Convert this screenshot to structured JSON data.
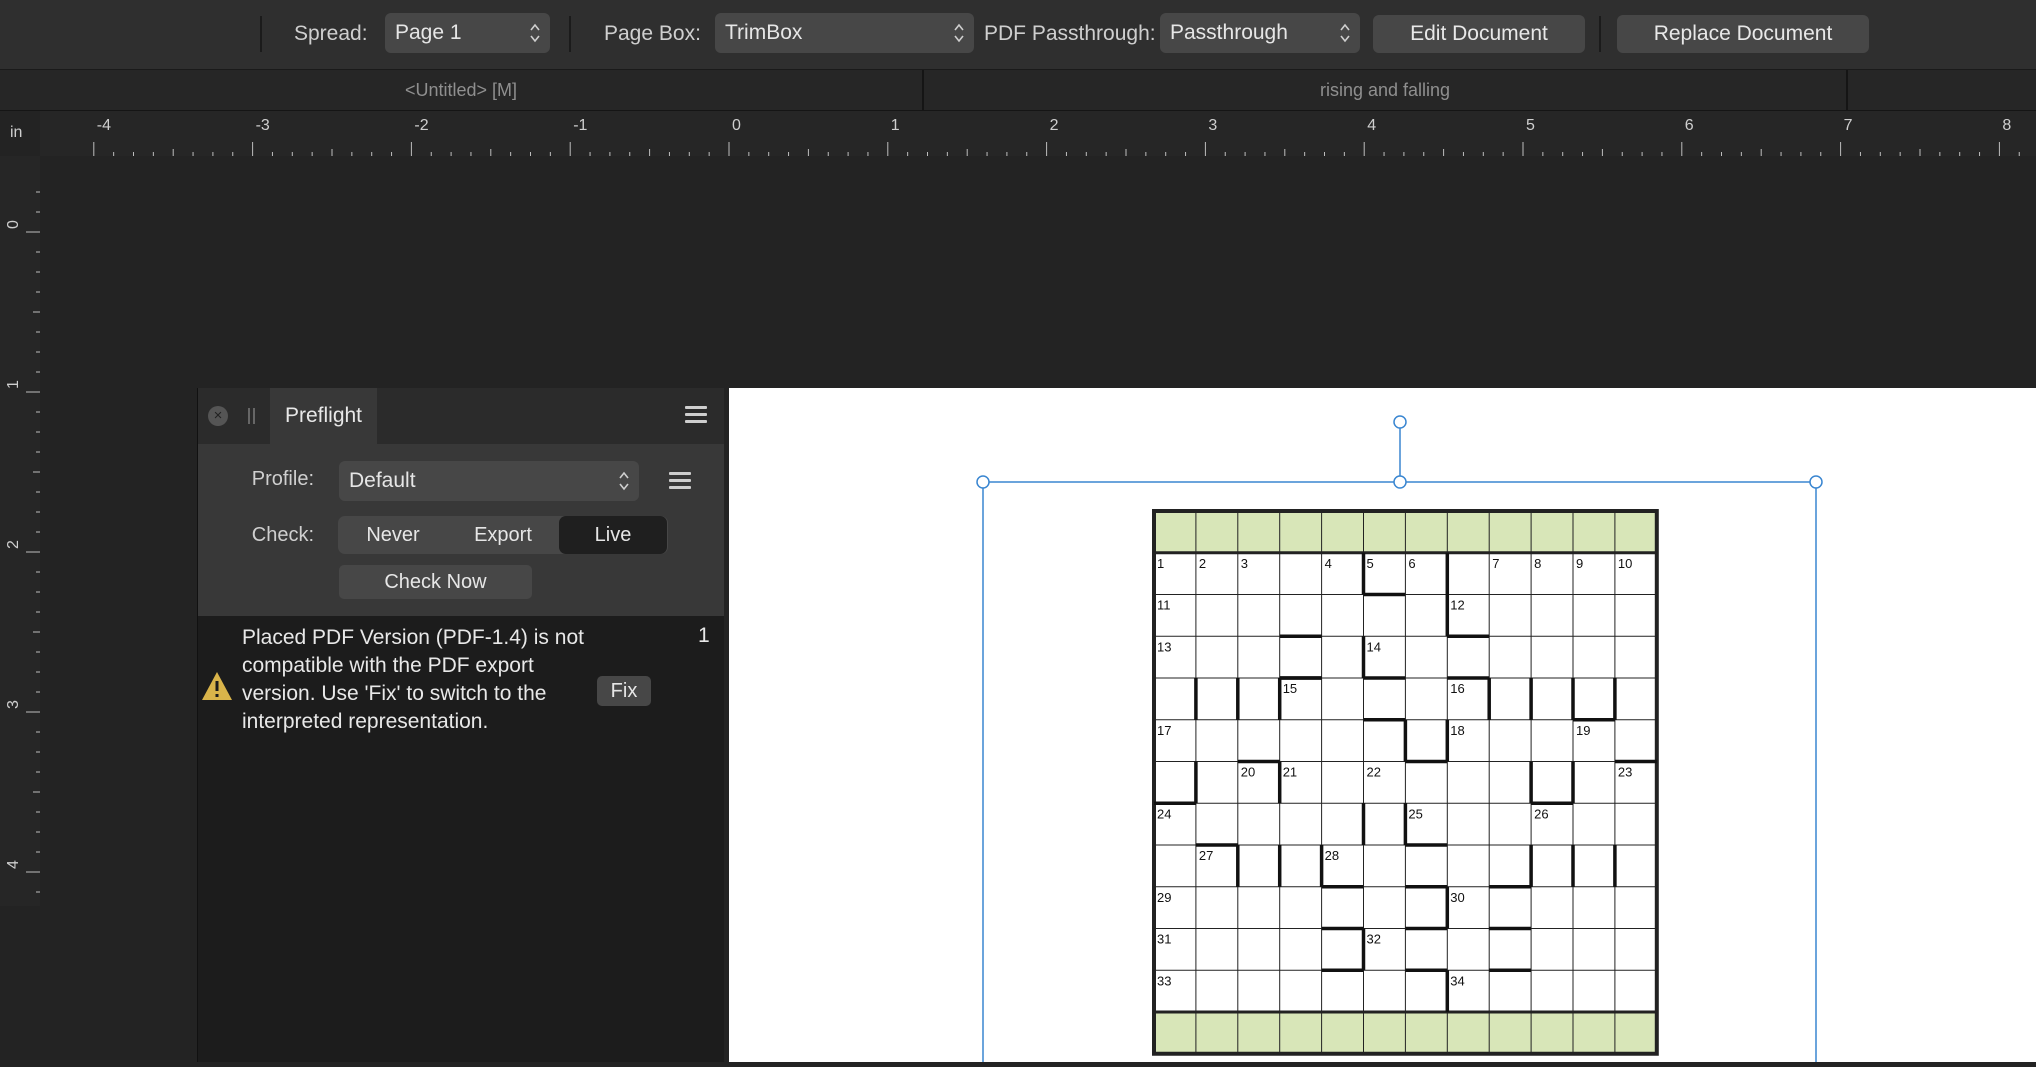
{
  "toolbar": {
    "spread_label": "Spread:",
    "spread_value": "Page 1",
    "pagebox_label": "Page Box:",
    "pagebox_value": "TrimBox",
    "passthrough_label": "PDF Passthrough:",
    "passthrough_value": "Passthrough",
    "edit_document": "Edit Document",
    "replace_document": "Replace Document"
  },
  "tabs": [
    {
      "label": "<Untitled> [M]"
    },
    {
      "label": "rising and falling"
    }
  ],
  "ruler": {
    "unit": "in",
    "h_labels": [
      "-4",
      "-3",
      "-2",
      "-1",
      "0",
      "1",
      "2",
      "3",
      "4",
      "5",
      "6",
      "7",
      "8"
    ],
    "v_labels": [
      "0",
      "1",
      "2",
      "3",
      "4"
    ]
  },
  "preflight": {
    "tab_label": "Preflight",
    "close_symbol": "×",
    "profile_label": "Profile:",
    "profile_value": "Default",
    "check_label": "Check:",
    "check_options": [
      "Never",
      "Export",
      "Live"
    ],
    "check_selected": "Live",
    "check_now": "Check Now",
    "issue": {
      "message": "Placed PDF Version (PDF-1.4) is not compatible with the PDF export version. Use 'Fix' to switch to the interpreted representation.",
      "count": "1",
      "fix_label": "Fix"
    }
  },
  "colors": {
    "selection": "#3a86d1",
    "grid_header_fill": "#d8e6b8",
    "warning": "#d9b44a"
  },
  "crossword": {
    "clue_numbers": [
      "1",
      "2",
      "3",
      "4",
      "5",
      "6",
      "7",
      "8",
      "9",
      "10",
      "11",
      "12",
      "13",
      "14",
      "15",
      "16",
      "17",
      "18",
      "19",
      "20",
      "21",
      "22",
      "23",
      "24",
      "25",
      "26",
      "27",
      "28",
      "29",
      "30",
      "31",
      "32",
      "33",
      "34"
    ]
  }
}
